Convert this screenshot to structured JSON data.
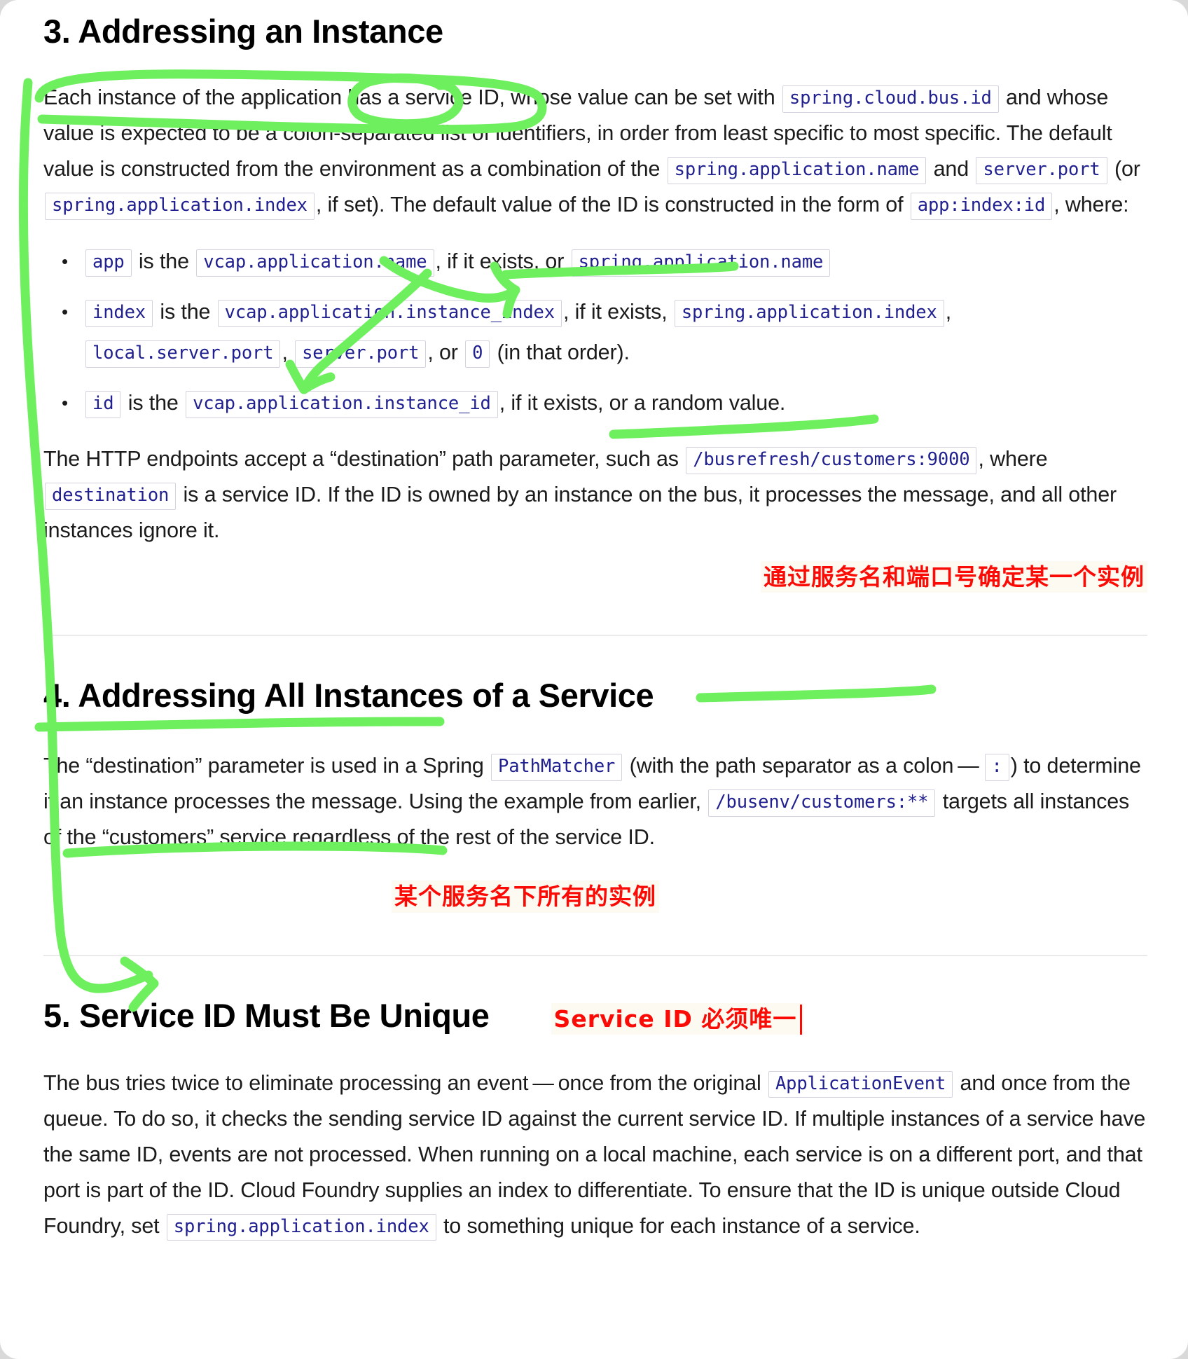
{
  "document": {
    "sections": [
      {
        "id": "sec3",
        "heading": "3. Addressing an Instance",
        "paragraph1": {
          "t1": "Each instance of the application has a service ID, whose value can be set with ",
          "c1": "spring.cloud.bus.id",
          "t2": " and whose value is expected to be a colon-separated list of identifiers, in order from least specific to most specific. The default value is constructed from the environment as a combination of the ",
          "c2": "spring.application.name",
          "t3": " and ",
          "c3": "server.port",
          "t4": " (or ",
          "c4": "spring.application.index",
          "t5": ", if set). The default value of the ID is constructed in the form of ",
          "c5": "app:index:id",
          "t6": ", where:"
        },
        "bullets": [
          {
            "c1": "app",
            "t1": " is the ",
            "c2": "vcap.application.name",
            "t2": ", if it exists, or ",
            "c3": "spring.application.name"
          },
          {
            "c1": "index",
            "t1": " is the ",
            "c2": "vcap.application.instance_index",
            "t2": ", if it exists, ",
            "c3": "spring.application.index",
            "t3": ", ",
            "c4": "local.server.port",
            "t4": ", ",
            "c5": "server.port",
            "t5": ", or ",
            "c6": "0",
            "t6": " (in that order)."
          },
          {
            "c1": "id",
            "t1": " is the ",
            "c2": "vcap.application.instance_id",
            "t2": ", if it exists, or a random value."
          }
        ],
        "paragraph2": {
          "t1": "The HTTP endpoints accept a “destination” path parameter, such as ",
          "c1": "/busrefresh/customers:9000",
          "t2": ", where ",
          "c2": "destination",
          "t3": " is a service ID. If the ID is owned by an instance on the bus, it processes the message, and all other instances ignore it."
        },
        "annotation": "通过服务名和端口号确定某一个实例"
      },
      {
        "id": "sec4",
        "heading": "4. Addressing All Instances of a Service",
        "paragraph1": {
          "t1": "The “destination” parameter is used in a Spring ",
          "c1": "PathMatcher",
          "t2": " (with the path separator as a colon — ",
          "c2": ":",
          "t3": ") to determine if an instance processes the message. Using the example from earlier, ",
          "c3": "/busenv/customers:**",
          "t4": " targets all instances of the “customers” service regardless of the rest of the service ID."
        },
        "annotation": "某个服务名下所有的实例"
      },
      {
        "id": "sec5",
        "heading": "5. Service ID Must Be Unique",
        "annotation": "Service ID 必须唯一",
        "paragraph1": {
          "t1": "The bus tries twice to eliminate processing an event — once from the original ",
          "c1": "ApplicationEvent",
          "t2": " and once from the queue. To do so, it checks the sending service ID against the current service ID. If multiple instances of a service have the same ID, events are not processed. When running on a local machine, each service is on a different port, and that port is part of the ID. Cloud Foundry supplies an index to differentiate. To ensure that the ID is unique outside Cloud Foundry, set ",
          "c2": "spring.application.index",
          "t3": " to something unique for each instance of a service."
        }
      }
    ]
  },
  "annotations": {
    "ink_color": "#6ef05e",
    "note_color": "#fb0b05",
    "note_highlight": "#fdfaf2",
    "code_color": "#202090",
    "code_border": "#d3d3e0"
  }
}
